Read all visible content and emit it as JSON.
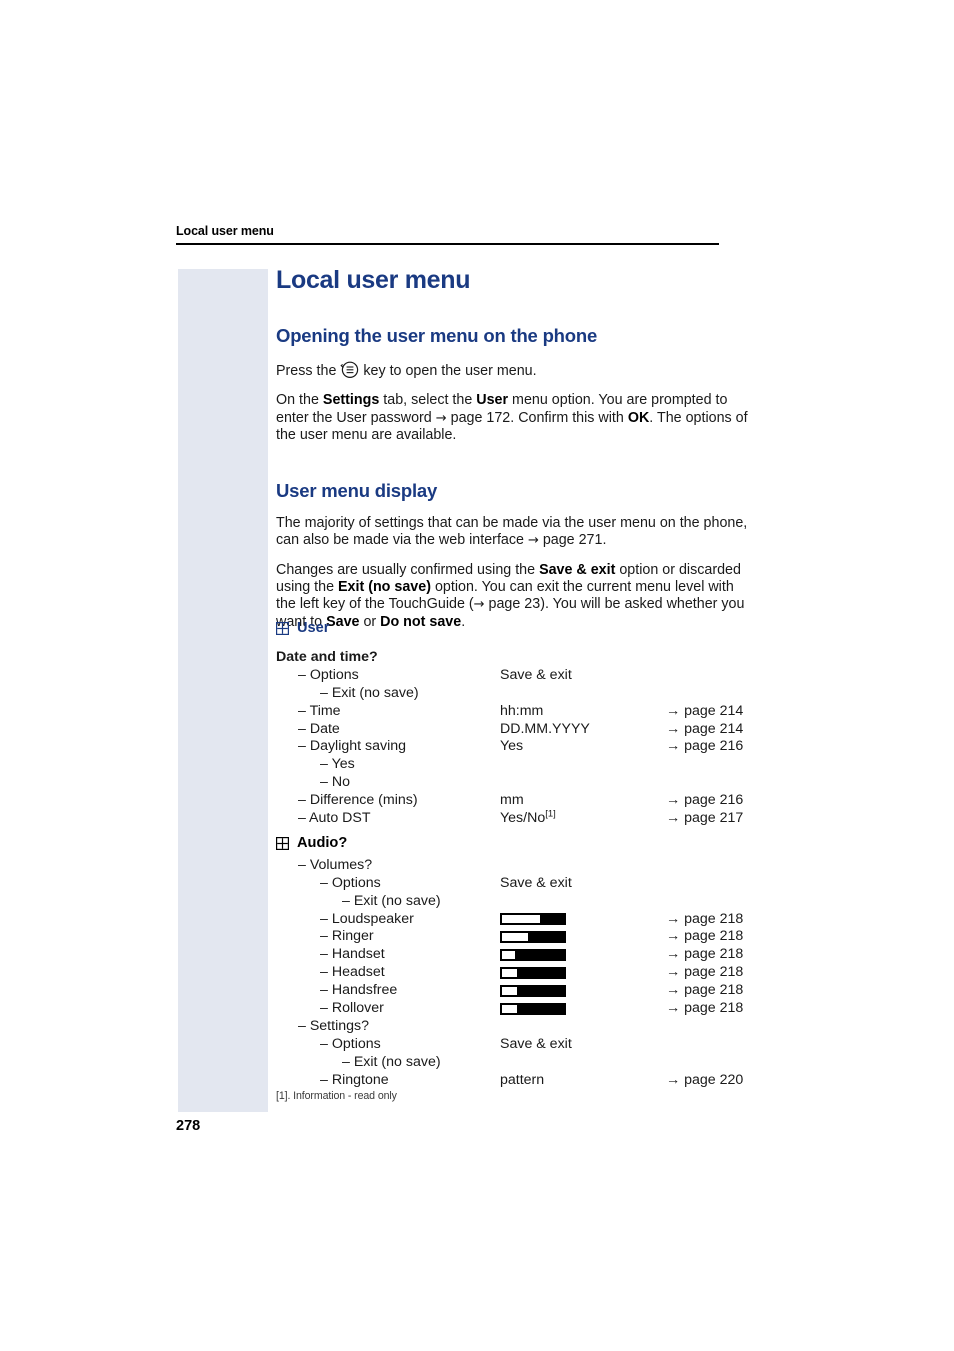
{
  "running_head": "Local user menu",
  "folio": "278",
  "page_title": "Local user menu",
  "sections": {
    "opening": {
      "heading": "Opening the user menu on the phone",
      "para1_before": "Press the ",
      "key_icon": "menu-key-icon",
      "para1_after": " key to open the user menu.",
      "para2": {
        "t1": "On the ",
        "b1": "Settings",
        "t2": " tab, select the ",
        "b2": "User",
        "t3": " menu option. You are prompted to enter the User password ",
        "arrow": "→",
        "t4": " page 172. Confirm this with ",
        "b3": "OK",
        "t5": ". The options of the user menu are available."
      }
    },
    "display": {
      "heading": "User menu display",
      "para1": {
        "t1": "The majority of settings that can be made via the user menu on the phone, can also be made via the web interface ",
        "arrow": "→",
        "t2": " page 271."
      },
      "para2": {
        "t1": "Changes are usually confirmed using the ",
        "b1": "Save & exit",
        "t2": " option or discarded using the ",
        "b2": "Exit (no save)",
        "t3": " option. You can exit the current menu level with the left key of the TouchGuide (",
        "arrow": "→",
        "t4": " page 23). You will be asked whether you want to ",
        "b3": "Save",
        "t5": " or ",
        "b4": "Do not save",
        "t6": "."
      }
    }
  },
  "menu_tree": {
    "groups": [
      {
        "icon": "plus-box-icon",
        "name": "User",
        "color": "#1a3a82",
        "rows": [
          {
            "level": 0,
            "label": "Date and time?",
            "value": "",
            "ref": ""
          },
          {
            "level": 1,
            "label": "– Options",
            "value": "Save & exit",
            "ref": ""
          },
          {
            "level": 2,
            "label": "– Exit (no save)",
            "value": "",
            "ref": ""
          },
          {
            "level": 1,
            "label": "– Time",
            "value": "hh:mm",
            "ref": "→ page 214"
          },
          {
            "level": 1,
            "label": "– Date",
            "value": "DD.MM.YYYY",
            "ref": "→ page 214"
          },
          {
            "level": 1,
            "label": "– Daylight saving",
            "value": "Yes",
            "ref": "→ page 216"
          },
          {
            "level": 2,
            "label": "– Yes",
            "value": "",
            "ref": ""
          },
          {
            "level": 2,
            "label": "– No",
            "value": "",
            "ref": ""
          },
          {
            "level": 1,
            "label": "– Difference (mins)",
            "value": "mm",
            "ref": "→ page 216"
          },
          {
            "level": 1,
            "label": "– Auto DST",
            "value": "Yes/No",
            "value_sup": "[1]",
            "ref": "→ page 217"
          }
        ]
      },
      {
        "icon": "plus-box-icon",
        "name": "Audio?",
        "color": "#000000",
        "rows": [
          {
            "level": 1,
            "label": "– Volumes?",
            "value": "",
            "ref": ""
          },
          {
            "level": 2,
            "label": "– Options",
            "value": "Save & exit",
            "ref": ""
          },
          {
            "level": 3,
            "label": "– Exit (no save)",
            "value": "",
            "ref": ""
          },
          {
            "level": 2,
            "label": "– Loudspeaker",
            "bar": 57,
            "ref": "→ page 218"
          },
          {
            "level": 2,
            "label": "– Ringer",
            "bar": 40,
            "ref": "→ page 218"
          },
          {
            "level": 2,
            "label": "– Handset",
            "bar": 20,
            "ref": "→ page 218"
          },
          {
            "level": 2,
            "label": "– Headset",
            "bar": 22,
            "ref": "→ page 218"
          },
          {
            "level": 2,
            "label": "– Handsfree",
            "bar": 22,
            "ref": "→ page 218"
          },
          {
            "level": 2,
            "label": "– Rollover",
            "bar": 22,
            "ref": "→ page 218"
          },
          {
            "level": 1,
            "label": "– Settings?",
            "value": "",
            "ref": ""
          },
          {
            "level": 2,
            "label": "– Options",
            "value": "Save & exit",
            "ref": ""
          },
          {
            "level": 3,
            "label": "– Exit (no save)",
            "value": "",
            "ref": ""
          },
          {
            "level": 2,
            "label": "– Ringtone",
            "value": "pattern",
            "ref": "→ page 220"
          }
        ]
      }
    ]
  },
  "footnote": "[1]. Information - read only"
}
